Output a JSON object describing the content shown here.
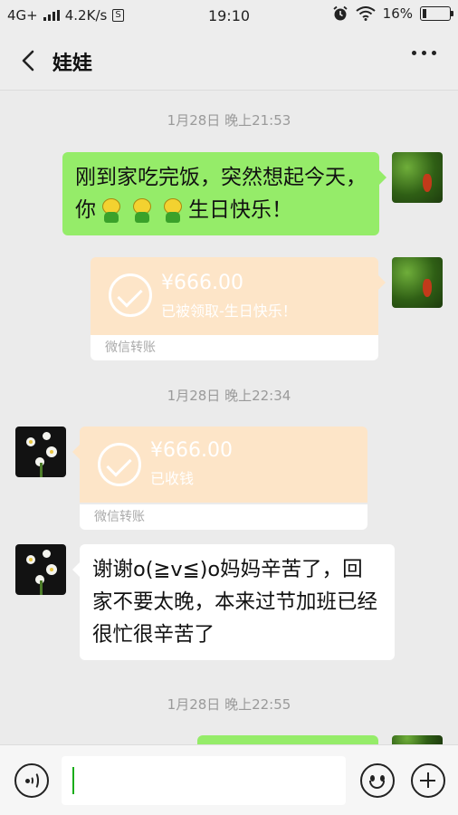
{
  "status_bar": {
    "network": "4G+",
    "speed": "4.2K/s",
    "speed_icon": "S",
    "time": "19:10",
    "battery": "16%",
    "battery_level": 0.16,
    "icons": [
      "signal-icon",
      "alarm-icon",
      "wifi-icon",
      "battery-icon"
    ]
  },
  "header": {
    "title": "娃娃",
    "back_icon": "chevron-left-icon",
    "more_icon": "more-dots-icon"
  },
  "messages": [
    {
      "type": "timestamp",
      "text": "1月28日 晚上21:53"
    },
    {
      "type": "text",
      "side": "right",
      "text_before": "刚到家吃完饭，突然想起今天，你",
      "emoji_count": 3,
      "text_after": "生日快乐！"
    },
    {
      "type": "transfer",
      "side": "right",
      "amount": "¥666.00",
      "note": "已被领取-生日快乐！",
      "footer": "微信转账"
    },
    {
      "type": "timestamp",
      "text": "1月28日 晚上22:34"
    },
    {
      "type": "transfer",
      "side": "left",
      "amount": "¥666.00",
      "note": "已收钱",
      "footer": "微信转账"
    },
    {
      "type": "text",
      "side": "left",
      "text": "谢谢o(≧v≦)o妈妈辛苦了，回家不要太晚，本来过节加班已经很忙很辛苦了"
    },
    {
      "type": "timestamp",
      "text": "1月28日 晚上22:55"
    }
  ],
  "input_bar": {
    "voice_icon": "voice-icon",
    "emoji_icon": "emoji-icon",
    "plus_icon": "plus-icon",
    "input_value": ""
  },
  "colors": {
    "background": "#ebebeb",
    "sent_bubble": "#95ec69",
    "received_bubble": "#ffffff",
    "transfer_card": "#fde5c8",
    "caret": "#1aad19"
  }
}
